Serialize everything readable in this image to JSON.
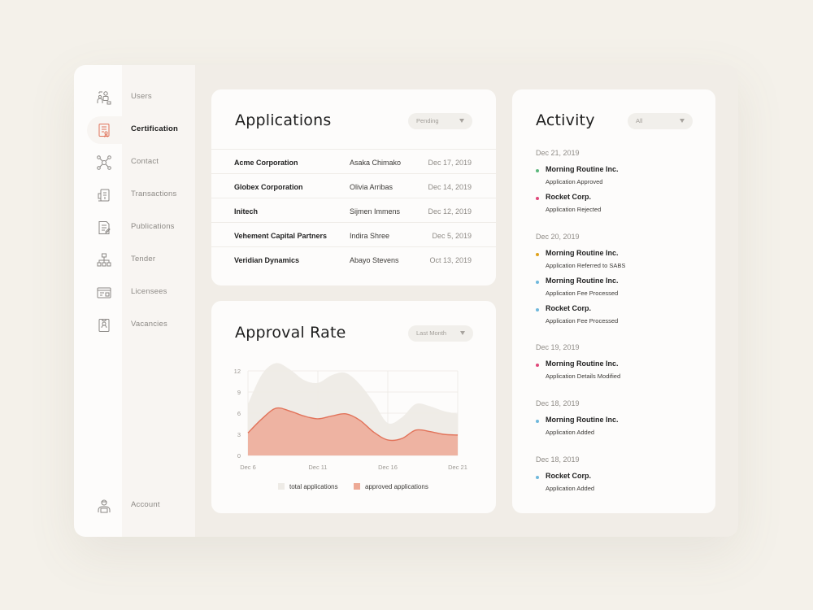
{
  "sidebar": {
    "items": [
      {
        "label": "Users",
        "icon": "users-icon"
      },
      {
        "label": "Certification",
        "icon": "certificate-icon",
        "active": true
      },
      {
        "label": "Contact",
        "icon": "contact-network-icon"
      },
      {
        "label": "Transactions",
        "icon": "transactions-icon"
      },
      {
        "label": "Publications",
        "icon": "publications-icon"
      },
      {
        "label": "Tender",
        "icon": "tender-hierarchy-icon"
      },
      {
        "label": "Licensees",
        "icon": "licensees-icon"
      },
      {
        "label": "Vacancies",
        "icon": "vacancies-icon"
      }
    ],
    "account": {
      "label": "Account",
      "icon": "account-avatar-icon"
    }
  },
  "applications": {
    "title": "Applications",
    "filter": "Pending",
    "rows": [
      {
        "company": "Acme Corporation",
        "contact": "Asaka Chimako",
        "date": "Dec 17, 2019"
      },
      {
        "company": "Globex Corporation",
        "contact": "Olivia Arribas",
        "date": "Dec 14, 2019"
      },
      {
        "company": "Initech",
        "contact": "Sijmen Immens",
        "date": "Dec 12, 2019"
      },
      {
        "company": "Vehement Capital Partners",
        "contact": "Indira Shree",
        "date": "Dec 5, 2019"
      },
      {
        "company": "Veridian Dynamics",
        "contact": "Abayo Stevens",
        "date": "Oct 13, 2019"
      }
    ]
  },
  "approval": {
    "title": "Approval Rate",
    "filter": "Last Month"
  },
  "chart_data": {
    "type": "area",
    "x": [
      "Dec 6",
      "Dec 7",
      "Dec 8",
      "Dec 9",
      "Dec 10",
      "Dec 11",
      "Dec 12",
      "Dec 13",
      "Dec 14",
      "Dec 15",
      "Dec 16",
      "Dec 17",
      "Dec 18",
      "Dec 19",
      "Dec 20",
      "Dec 21"
    ],
    "x_ticks": [
      "Dec 6",
      "Dec 11",
      "Dec 16",
      "Dec 21"
    ],
    "y_ticks": [
      0,
      3,
      6,
      9,
      12
    ],
    "ylim": [
      0,
      12
    ],
    "grid": true,
    "legend_position": "bottom",
    "series": [
      {
        "name": "total applications",
        "color": "#eeebe6",
        "values": [
          7.3,
          11.5,
          13.1,
          12.2,
          10.7,
          10.3,
          11.4,
          11.7,
          10.1,
          7.5,
          4.6,
          5.4,
          7.3,
          7.0,
          6.3,
          5.9
        ]
      },
      {
        "name": "approved applications",
        "color": "#eda995",
        "values": [
          3.2,
          5.2,
          6.7,
          6.3,
          5.6,
          5.2,
          5.6,
          5.9,
          5.0,
          3.3,
          2.2,
          2.4,
          3.6,
          3.4,
          3.0,
          2.9
        ]
      }
    ]
  },
  "activity": {
    "title": "Activity",
    "filter": "All",
    "groups": [
      {
        "date": "Dec 21, 2019",
        "items": [
          {
            "name": "Morning Routine Inc.",
            "status": "Application Approved",
            "color": "#5cb77c"
          },
          {
            "name": "Rocket Corp.",
            "status": "Application Rejected",
            "color": "#e0487a"
          }
        ]
      },
      {
        "date": "Dec 20, 2019",
        "items": [
          {
            "name": "Morning Routine Inc.",
            "status": "Application Referred to SABS",
            "color": "#e0a21c"
          },
          {
            "name": "Morning Routine Inc.",
            "status": "Application Fee Processed",
            "color": "#6fb8dc"
          },
          {
            "name": "Rocket Corp.",
            "status": "Application Fee Processed",
            "color": "#6fb8dc"
          }
        ]
      },
      {
        "date": "Dec 19, 2019",
        "items": [
          {
            "name": "Morning Routine Inc.",
            "status": "Application Details Modified",
            "color": "#e0487a"
          }
        ]
      },
      {
        "date": "Dec 18, 2019",
        "items": [
          {
            "name": "Morning Routine Inc.",
            "status": "Application Added",
            "color": "#6fb8dc"
          }
        ]
      },
      {
        "date": "Dec 18, 2019",
        "items": [
          {
            "name": "Rocket Corp.",
            "status": "Application Added",
            "color": "#6fb8dc"
          }
        ]
      }
    ]
  }
}
